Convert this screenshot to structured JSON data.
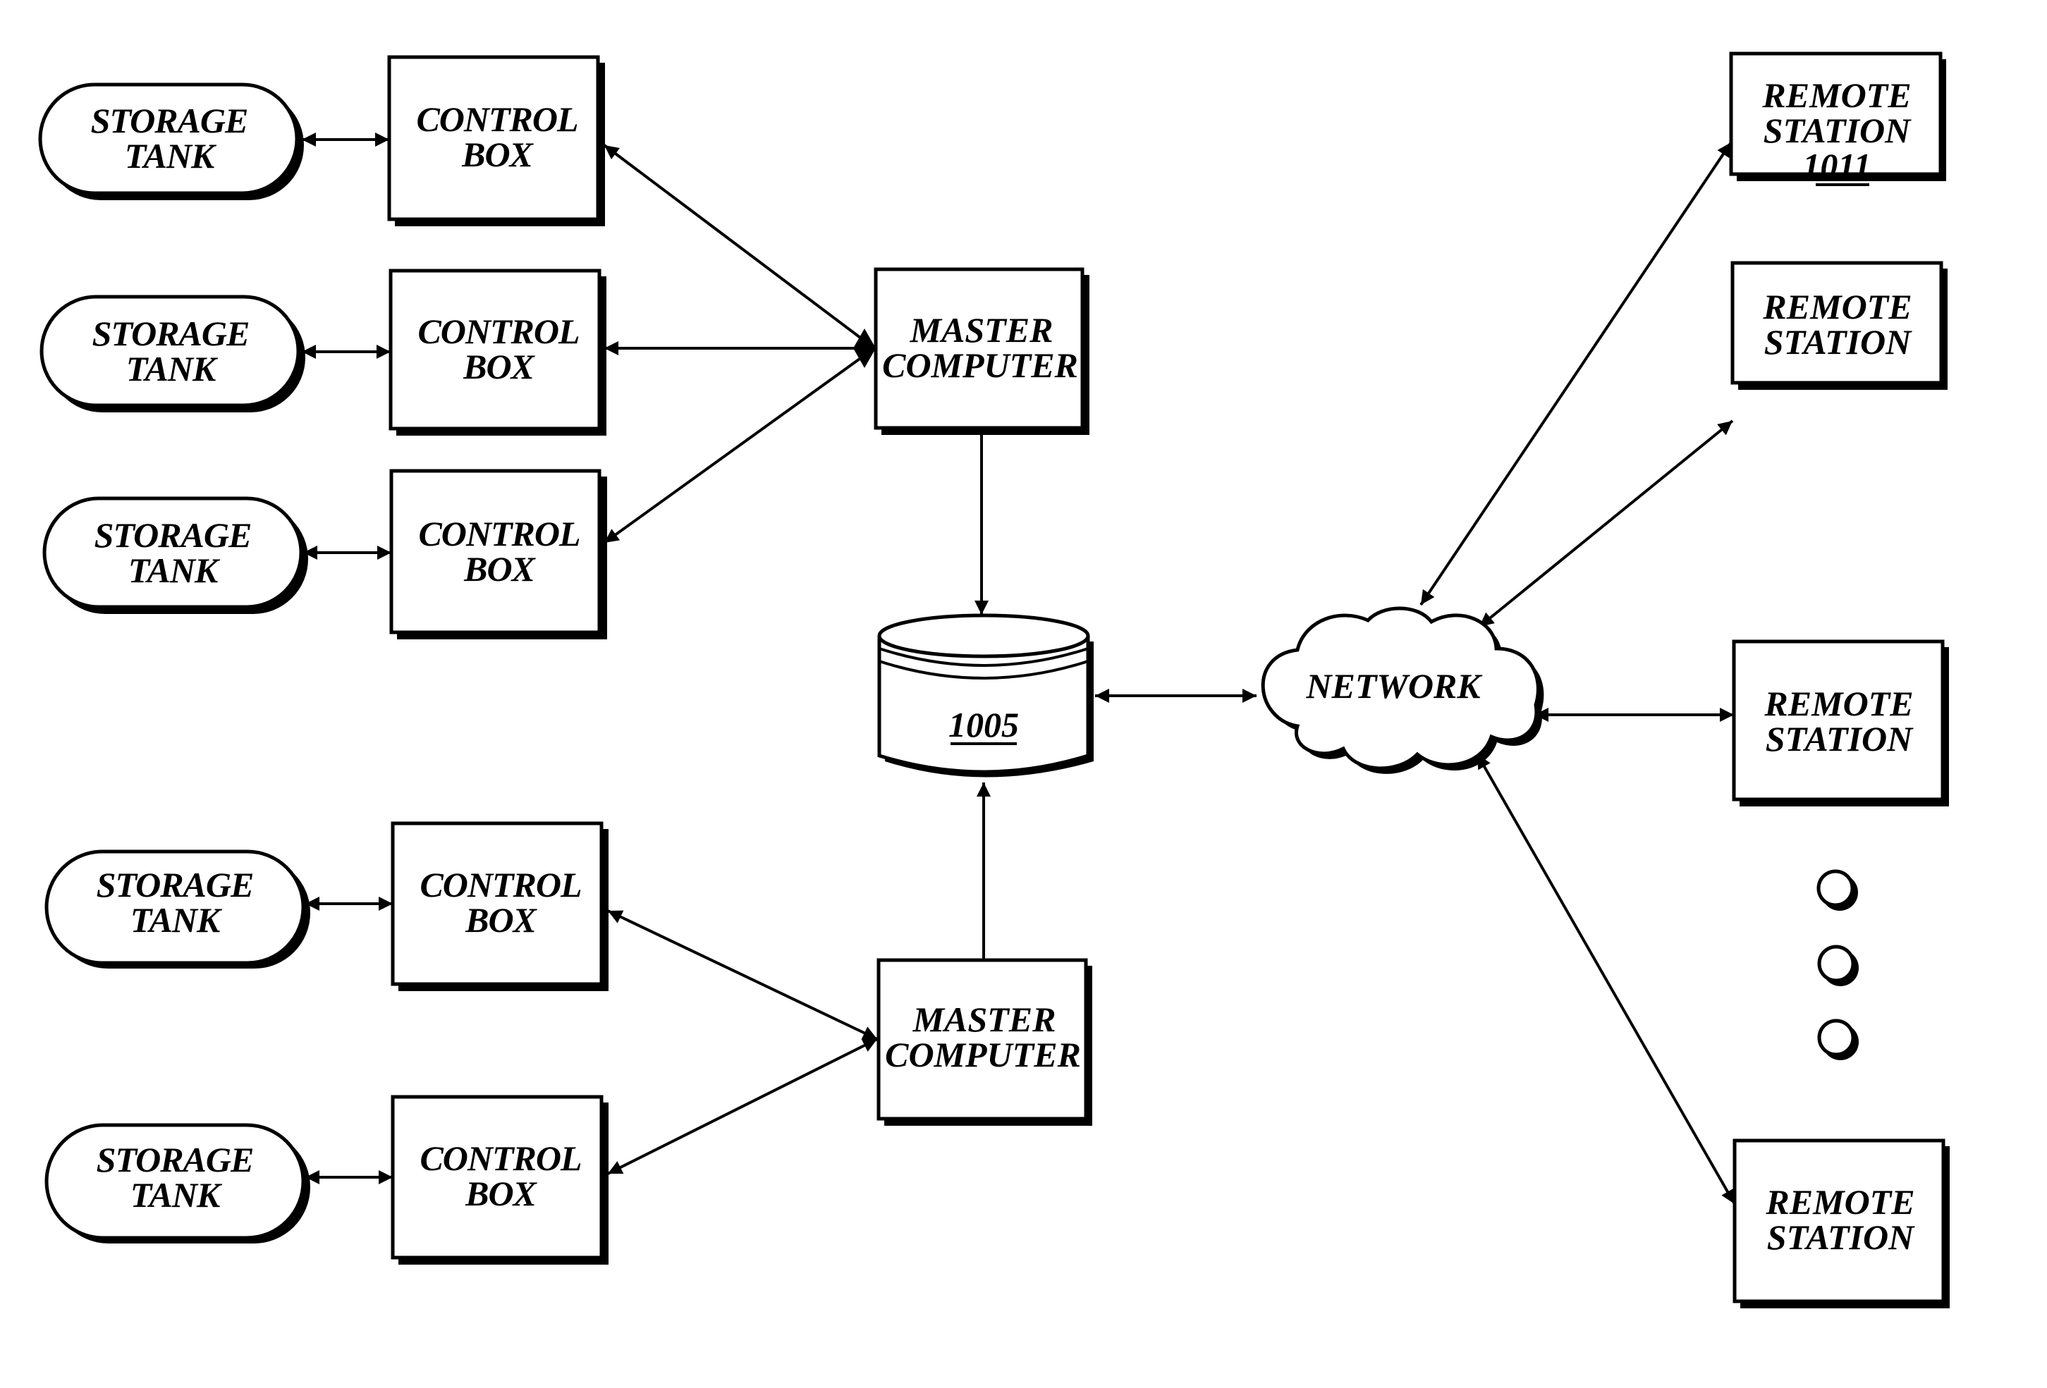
{
  "diagram": {
    "storage_tanks": [
      {
        "line1": "STORAGE",
        "line2": "TANK"
      },
      {
        "line1": "STORAGE",
        "line2": "TANK"
      },
      {
        "line1": "STORAGE",
        "line2": "TANK"
      },
      {
        "line1": "STORAGE",
        "line2": "TANK"
      },
      {
        "line1": "STORAGE",
        "line2": "TANK"
      }
    ],
    "control_boxes": [
      {
        "line1": "CONTROL",
        "line2": "BOX"
      },
      {
        "line1": "CONTROL",
        "line2": "BOX"
      },
      {
        "line1": "CONTROL",
        "line2": "BOX"
      },
      {
        "line1": "CONTROL",
        "line2": "BOX"
      },
      {
        "line1": "CONTROL",
        "line2": "BOX"
      }
    ],
    "master_computers": [
      {
        "line1": "MASTER",
        "line2": "COMPUTER"
      },
      {
        "line1": "MASTER",
        "line2": "COMPUTER"
      }
    ],
    "database": {
      "ref": "1005"
    },
    "network": {
      "label": "NETWORK"
    },
    "remote_stations": [
      {
        "line1": "REMOTE",
        "line2": "STATION",
        "ref": "1011"
      },
      {
        "line1": "REMOTE",
        "line2": "STATION"
      },
      {
        "line1": "REMOTE",
        "line2": "STATION"
      },
      {
        "line1": "REMOTE",
        "line2": "STATION"
      }
    ],
    "ellipsis": {
      "count": 3,
      "meaning": "more remote stations"
    },
    "connections": [
      {
        "from": "storage-tank-1",
        "to": "control-box-1",
        "type": "bidirectional"
      },
      {
        "from": "storage-tank-2",
        "to": "control-box-2",
        "type": "bidirectional"
      },
      {
        "from": "storage-tank-3",
        "to": "control-box-3",
        "type": "bidirectional"
      },
      {
        "from": "storage-tank-4",
        "to": "control-box-4",
        "type": "bidirectional"
      },
      {
        "from": "storage-tank-5",
        "to": "control-box-5",
        "type": "bidirectional"
      },
      {
        "from": "control-box-1",
        "to": "master-computer-1",
        "type": "bidirectional"
      },
      {
        "from": "control-box-2",
        "to": "master-computer-1",
        "type": "bidirectional"
      },
      {
        "from": "control-box-3",
        "to": "master-computer-1",
        "type": "bidirectional"
      },
      {
        "from": "control-box-4",
        "to": "master-computer-2",
        "type": "bidirectional"
      },
      {
        "from": "control-box-5",
        "to": "master-computer-2",
        "type": "bidirectional"
      },
      {
        "from": "master-computer-1",
        "to": "database-1005",
        "type": "directed"
      },
      {
        "from": "master-computer-2",
        "to": "database-1005",
        "type": "directed"
      },
      {
        "from": "database-1005",
        "to": "network",
        "type": "bidirectional"
      },
      {
        "from": "network",
        "to": "remote-station-1",
        "type": "bidirectional"
      },
      {
        "from": "network",
        "to": "remote-station-2",
        "type": "bidirectional"
      },
      {
        "from": "network",
        "to": "remote-station-3",
        "type": "bidirectional"
      },
      {
        "from": "network",
        "to": "remote-station-4",
        "type": "bidirectional"
      }
    ]
  }
}
